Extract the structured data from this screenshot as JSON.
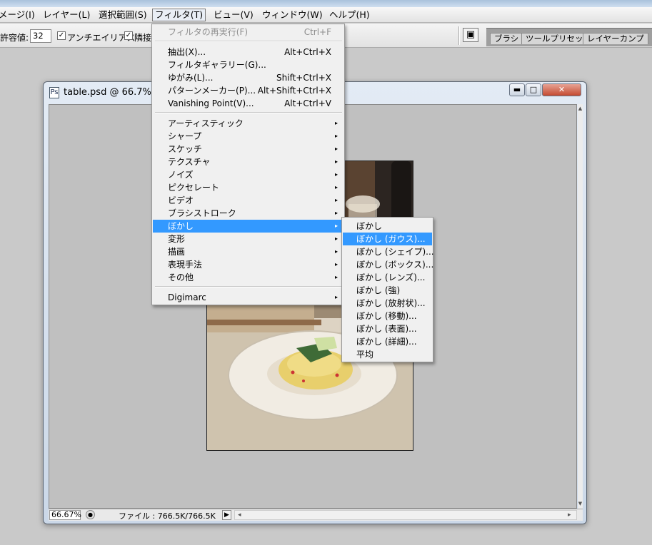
{
  "menubar": {
    "items": [
      {
        "label": "メージ(I)"
      },
      {
        "label": "レイヤー(L)"
      },
      {
        "label": "選択範囲(S)"
      },
      {
        "label": "フィルタ(T)"
      },
      {
        "label": "ビュー(V)"
      },
      {
        "label": "ウィンドウ(W)"
      },
      {
        "label": "ヘルプ(H)"
      }
    ]
  },
  "options": {
    "tolerance_label": "許容値:",
    "tolerance_value": "32",
    "antialias_label": "アンチエイリアス",
    "contiguous_label": "隣接",
    "antialias_checked": true,
    "contiguous_checked": true
  },
  "palette_tabs": [
    "ブラシ",
    "ツールプリセット",
    "レイヤーカンプ"
  ],
  "document": {
    "title": "table.psd @ 66.7% (",
    "zoom": "66.67%",
    "file_info": "ファイル : 766.5K/766.5K"
  },
  "filter_menu": {
    "items": [
      {
        "label": "フィルタの再実行(F)",
        "shortcut": "Ctrl+F",
        "disabled": true
      },
      {
        "label": "抽出(X)...",
        "shortcut": "Alt+Ctrl+X"
      },
      {
        "label": "フィルタギャラリー(G)...",
        "shortcut": ""
      },
      {
        "label": "ゆがみ(L)...",
        "shortcut": "Shift+Ctrl+X"
      },
      {
        "label": "パターンメーカー(P)...",
        "shortcut": "Alt+Shift+Ctrl+X"
      },
      {
        "label": "Vanishing Point(V)...",
        "shortcut": "Alt+Ctrl+V"
      },
      {
        "label": "アーティスティック"
      },
      {
        "label": "シャープ"
      },
      {
        "label": "スケッチ"
      },
      {
        "label": "テクスチャ"
      },
      {
        "label": "ノイズ"
      },
      {
        "label": "ピクセレート"
      },
      {
        "label": "ビデオ"
      },
      {
        "label": "ブラシストローク"
      },
      {
        "label": "ぼかし"
      },
      {
        "label": "変形"
      },
      {
        "label": "描画"
      },
      {
        "label": "表現手法"
      },
      {
        "label": "その他"
      },
      {
        "label": "Digimarc"
      }
    ]
  },
  "blur_submenu": {
    "items": [
      {
        "label": "ぼかし"
      },
      {
        "label": "ぼかし (ガウス)..."
      },
      {
        "label": "ぼかし (シェイプ)..."
      },
      {
        "label": "ぼかし (ボックス)..."
      },
      {
        "label": "ぼかし (レンズ)..."
      },
      {
        "label": "ぼかし (強)"
      },
      {
        "label": "ぼかし (放射状)..."
      },
      {
        "label": "ぼかし (移動)..."
      },
      {
        "label": "ぼかし (表面)..."
      },
      {
        "label": "ぼかし (詳細)..."
      },
      {
        "label": "平均"
      }
    ]
  },
  "icons": {
    "arrow_right": "▸",
    "check": "✓",
    "minimize": "▬",
    "maximize": "□",
    "close": "✕",
    "scroll_up": "▲",
    "scroll_down": "▼",
    "scroll_left": "◂",
    "scroll_right": "▸",
    "play": "▶"
  },
  "colors": {
    "highlight": "#3399ff",
    "menu_bg": "#f0f0f0",
    "canvas_bg": "#c0c0c0",
    "workspace_bg": "#c9c9c9"
  }
}
